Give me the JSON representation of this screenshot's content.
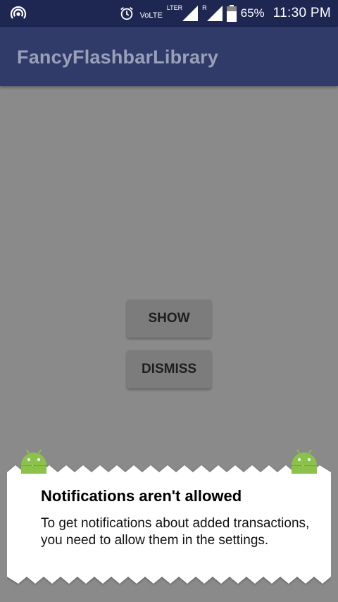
{
  "status_bar": {
    "volte": "VoLTE",
    "lte": "LTE",
    "roaming": "R",
    "battery": "65%",
    "time": "11:30 PM",
    "icons": [
      "hotspot-icon",
      "alarm-icon",
      "signal-icon",
      "battery-icon"
    ]
  },
  "app_bar": {
    "title": "FancyFlashbarLibrary"
  },
  "buttons": {
    "show": "SHOW",
    "dismiss": "DISMISS"
  },
  "flashbar": {
    "title": "Notifications aren't allowed",
    "message": "To get notifications about added transactions, you need to allow them in the settings.",
    "icon": "android-icon"
  },
  "colors": {
    "status_bar": "#1e2752",
    "app_bar": "#303b6a",
    "scrim": "#8a8a8a",
    "button": "#7c7c7c",
    "android_green": "#8bc34a"
  }
}
